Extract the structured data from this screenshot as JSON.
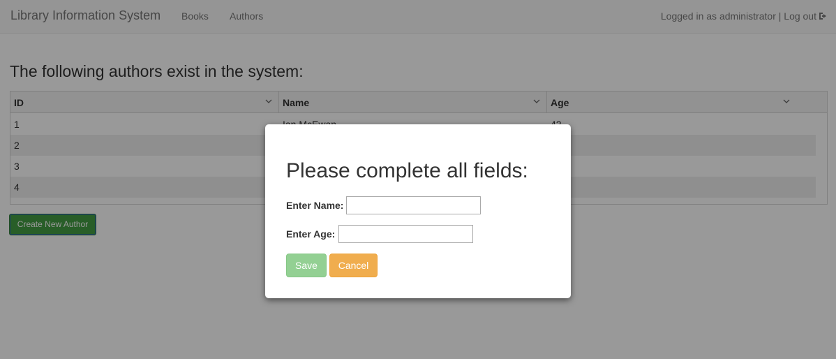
{
  "navbar": {
    "brand": "Library Information System",
    "links": [
      "Books",
      "Authors"
    ],
    "user_status": "Logged in as administrator | Log out"
  },
  "page": {
    "heading": "The following authors exist in the system:"
  },
  "grid": {
    "columns": [
      "ID",
      "Name",
      "Age"
    ],
    "rows": [
      {
        "id": "1",
        "name": "Ian McEwan",
        "age": "42"
      },
      {
        "id": "2",
        "name": "",
        "age": ""
      },
      {
        "id": "3",
        "name": "",
        "age": ""
      },
      {
        "id": "4",
        "name": "",
        "age": ""
      }
    ]
  },
  "actions": {
    "create_label": "Create New Author"
  },
  "modal": {
    "title": "Please complete all fields:",
    "name_label": "Enter Name:",
    "name_value": "",
    "age_label": "Enter Age:",
    "age_value": "",
    "save_label": "Save",
    "cancel_label": "Cancel"
  },
  "colors": {
    "save": "#93d093",
    "cancel": "#f0ad4e",
    "create": "#449d44"
  }
}
